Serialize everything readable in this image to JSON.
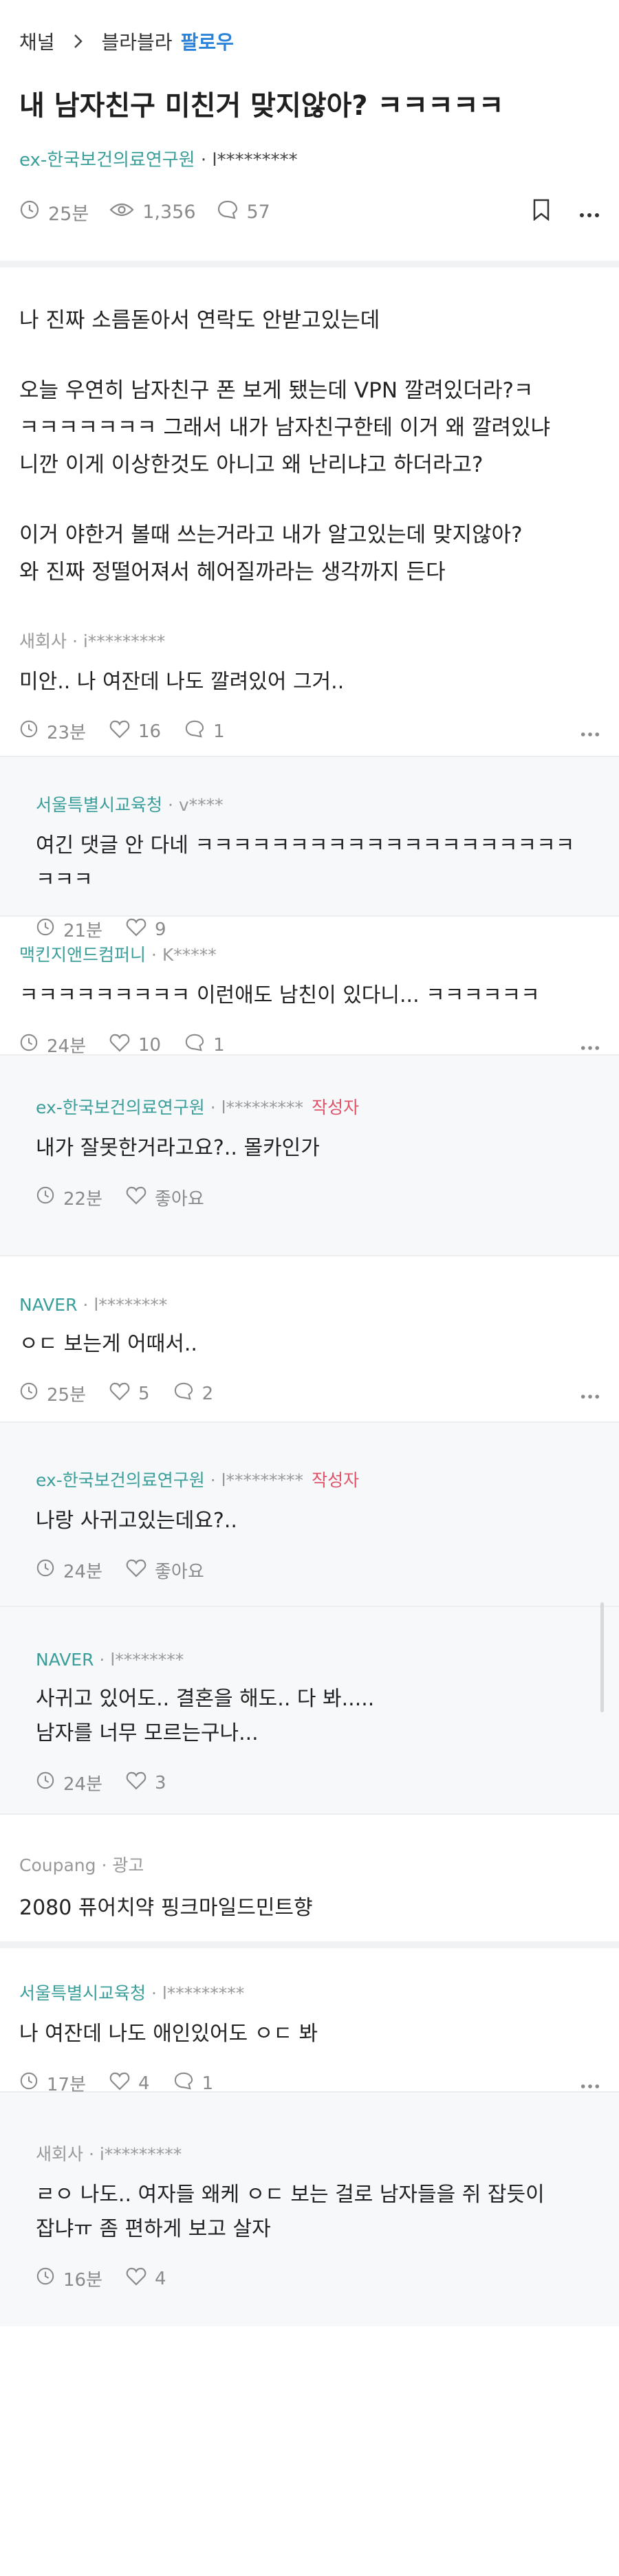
{
  "breadcrumb": {
    "channel": "채널",
    "board": "블라블라",
    "follow": "팔로우"
  },
  "post": {
    "title": "내 남자친구 미친거 맞지않아? ㅋㅋㅋㅋㅋ",
    "org": "ex-한국보건의료연구원",
    "nick": "l*********",
    "time": "25분",
    "views": "1,356",
    "comments": "57",
    "body": {
      "p1": "나 진짜 소름돋아서 연락도 안받고있는데",
      "p2a": "오늘 우연히 남자친구 폰 보게 됐는데 VPN 깔려있더라?ㅋ",
      "p2b": "ㅋㅋㅋㅋㅋㅋㅋ 그래서 내가 남자친구한테 이거 왜 깔려있냐",
      "p2c": "니깐 이게 이상한것도 아니고 왜 난리냐고 하더라고?",
      "p3a": "이거 야한거 볼때 쓰는거라고 내가 알고있는데 맞지않아?",
      "p3b": "와 진짜 정떨어져서 헤어질까라는 생각까지 든다"
    }
  },
  "comments": [
    {
      "org": "새회사",
      "nick": "i*********",
      "text": "미안.. 나 여잔데 나도 깔려있어 그거..",
      "time": "23분",
      "likes": "16",
      "replies": "1"
    },
    {
      "org": "서울특별시교육청",
      "nick": "v****",
      "text1": "여긴 댓글 안 다네 ㅋㅋㅋㅋㅋㅋㅋㅋㅋㅋㅋㅋㅋㅋㅋㅋㅋㅋㅋㅋ",
      "text2": "ㅋㅋㅋ",
      "time": "21분",
      "likes": "9"
    },
    {
      "org": "맥킨지앤드컴퍼니",
      "nick": "K*****",
      "text": "ㅋㅋㅋㅋㅋㅋㅋㅋㅋ 이런애도 남친이 있다니... ㅋㅋㅋㅋㅋㅋ",
      "time": "24분",
      "likes": "10",
      "replies": "1"
    },
    {
      "org": "ex-한국보건의료연구원",
      "nick": "l*********",
      "tag": "작성자",
      "text": "내가 잘못한거라고요?.. 몰카인가",
      "time": "22분",
      "likes": "좋아요"
    },
    {
      "org": "NAVER",
      "nick": "l********",
      "text": "ㅇㄷ 보는게 어때서..",
      "time": "25분",
      "likes": "5",
      "replies": "2"
    },
    {
      "org": "ex-한국보건의료연구원",
      "nick": "l*********",
      "tag": "작성자",
      "text": "나랑 사귀고있는데요?..",
      "time": "24분",
      "likes": "좋아요"
    },
    {
      "org": "NAVER",
      "nick": "l********",
      "text1": "사귀고 있어도.. 결혼을 해도.. 다 봐.....",
      "text2": "남자를 너무 모르는구나...",
      "time": "24분",
      "likes": "3"
    },
    {
      "org": "서울특별시교육청",
      "nick": "l*********",
      "text": "나 여잔데 나도 애인있어도 ㅇㄷ 봐",
      "time": "17분",
      "likes": "4",
      "replies": "1"
    },
    {
      "org": "새회사",
      "nick": "i*********",
      "text1": "ㄹㅇ 나도.. 여자들 왜케 ㅇㄷ 보는 걸로 남자들을 쥐 잡듯이",
      "text2": "잡냐ㅠ 좀 편하게 보고 살자",
      "time": "16분",
      "likes": "4"
    }
  ],
  "ad": {
    "brand": "Coupang",
    "label": "광고",
    "title": "2080 퓨어치약 핑크마일드민트향"
  },
  "colors": {
    "org": "#3a9e9a",
    "follow": "#2a83d8",
    "author_tag": "#e0546a",
    "reply_bg": "#f7f8fa"
  },
  "icons": [
    "chevron-right-icon",
    "clock-icon",
    "eye-icon",
    "chat-bubble-icon",
    "bookmark-icon",
    "more-icon",
    "heart-icon"
  ]
}
